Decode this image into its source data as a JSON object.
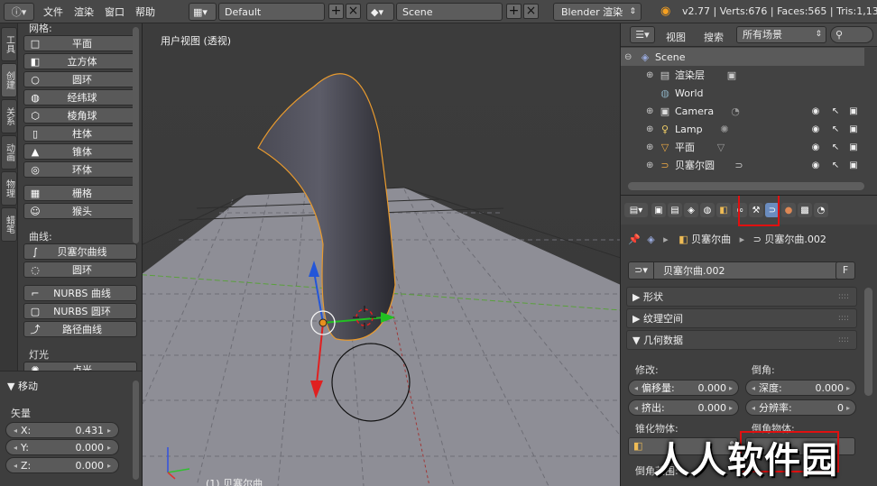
{
  "topbar": {
    "menus": [
      "文件",
      "渲染",
      "窗口",
      "帮助"
    ],
    "screen": "Default",
    "scene": "Scene",
    "engine": "Blender 渲染",
    "info": "v2.77 | Verts:676 | Faces:565 | Tris:1,130"
  },
  "tabs": [
    "工具",
    "创建",
    "关系",
    "动画",
    "物理",
    "蜡笔"
  ],
  "tool": {
    "mesh_group": "网格:",
    "mesh": [
      {
        "label": "平面",
        "icon": "plane-icon"
      },
      {
        "label": "立方体",
        "icon": "cube-icon"
      },
      {
        "label": "圆环",
        "icon": "circle-icon"
      },
      {
        "label": "经纬球",
        "icon": "uvsphere-icon"
      },
      {
        "label": "棱角球",
        "icon": "icosphere-icon"
      },
      {
        "label": "柱体",
        "icon": "cylinder-icon"
      },
      {
        "label": "锥体",
        "icon": "cone-icon"
      },
      {
        "label": "环体",
        "icon": "torus-icon"
      },
      {
        "label": "栅格",
        "icon": "grid-icon"
      },
      {
        "label": "猴头",
        "icon": "monkey-icon"
      }
    ],
    "curve_group": "曲线:",
    "curve": [
      {
        "label": "贝塞尔曲线",
        "icon": "bezier-curve-icon"
      },
      {
        "label": "圆环",
        "icon": "bezier-circle-icon"
      },
      {
        "label": "NURBS 曲线",
        "icon": "nurbs-curve-icon"
      },
      {
        "label": "NURBS 圆环",
        "icon": "nurbs-circle-icon"
      },
      {
        "label": "路径曲线",
        "icon": "path-icon"
      }
    ],
    "lamp_group": "灯光",
    "lamp": [
      {
        "label": "点光",
        "icon": "point-lamp-icon"
      }
    ]
  },
  "operator": {
    "title": "移动",
    "vector_label": "矢量",
    "x_label": "X:",
    "x": "0.431",
    "y_label": "Y:",
    "y": "0.000",
    "z_label": "Z:",
    "z": "0.000"
  },
  "viewport": {
    "title": "用户视图 (透视)",
    "object_label": "(1) 贝塞尔曲"
  },
  "outliner": {
    "view": "视图",
    "search": "搜索",
    "filter": "所有场景",
    "rows": [
      {
        "label": "Scene",
        "icon": "scene-icon"
      },
      {
        "label": "渲染层",
        "icon": "render-layers-icon"
      },
      {
        "label": "World",
        "icon": "world-icon"
      },
      {
        "label": "Camera",
        "icon": "camera-icon"
      },
      {
        "label": "Lamp",
        "icon": "lamp-icon"
      },
      {
        "label": "平面",
        "icon": "mesh-icon"
      },
      {
        "label": "贝塞尔圆",
        "icon": "curve-icon"
      }
    ]
  },
  "properties": {
    "breadcrumb_obj": "贝塞尔曲",
    "breadcrumb_data": "贝塞尔曲.002",
    "datablock_name": "贝塞尔曲.002",
    "fake_user": "F",
    "sections": {
      "shape": "形状",
      "texture_space": "纹理空间",
      "geometry": "几何数据"
    },
    "modify_label": "修改:",
    "bevel_label": "倒角:",
    "offset_label": "偏移量:",
    "offset": "0.000",
    "depth_label": "深度:",
    "depth": "0.000",
    "extrude_label": "挤出:",
    "extrude": "0.000",
    "resolution_label": "分辨率:",
    "resolution": "0",
    "taper_label": "锥化物体:",
    "bevel_obj_label": "倒角物体:",
    "bevel_range_label": "倒角范围:"
  },
  "watermark": "人人软件园"
}
